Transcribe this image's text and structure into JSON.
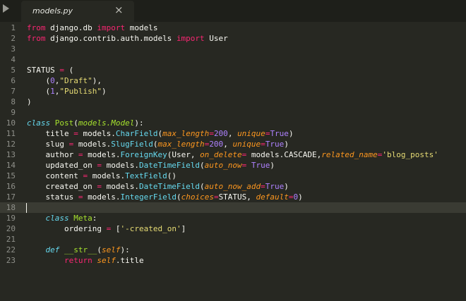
{
  "tab": {
    "title": "models.py",
    "close_glyph": "×"
  },
  "colors": {
    "background": "#272822",
    "tabbar": "#1e1f1a",
    "current_line": "#3a3b33",
    "gutter_text": "#8f908a",
    "keyword": "#f92672",
    "string": "#e6db74",
    "number": "#ae81ff",
    "function": "#66d9ef",
    "class_name": "#a6e22e",
    "argument": "#fd971f"
  },
  "icons": {
    "sidebar_toggle": "triangle-right-icon",
    "close": "close-icon"
  },
  "editor": {
    "current_line": 18,
    "lines": [
      [
        [
          "kw",
          "from"
        ],
        [
          "plain",
          " django.db "
        ],
        [
          "kw",
          "import"
        ],
        [
          "plain",
          " models"
        ]
      ],
      [
        [
          "kw",
          "from"
        ],
        [
          "plain",
          " django.contrib.auth.models "
        ],
        [
          "kw",
          "import"
        ],
        [
          "plain",
          " User"
        ]
      ],
      [],
      [],
      [
        [
          "plain",
          "STATUS "
        ],
        [
          "op",
          "="
        ],
        [
          "plain",
          " ("
        ]
      ],
      [
        [
          "plain",
          "    ("
        ],
        [
          "num",
          "0"
        ],
        [
          "plain",
          ","
        ],
        [
          "str",
          "\"Draft\""
        ],
        [
          "plain",
          "),"
        ]
      ],
      [
        [
          "plain",
          "    ("
        ],
        [
          "num",
          "1"
        ],
        [
          "plain",
          ","
        ],
        [
          "str",
          "\"Publish\""
        ],
        [
          "plain",
          ")"
        ]
      ],
      [
        [
          "plain",
          ")"
        ]
      ],
      [],
      [
        [
          "def",
          "class"
        ],
        [
          "plain",
          " "
        ],
        [
          "cls",
          "Post"
        ],
        [
          "plain",
          "("
        ],
        [
          "base",
          "models.Model"
        ],
        [
          "plain",
          "):"
        ]
      ],
      [
        [
          "plain",
          "    title "
        ],
        [
          "op",
          "="
        ],
        [
          "plain",
          " models."
        ],
        [
          "fn",
          "CharField"
        ],
        [
          "plain",
          "("
        ],
        [
          "arg",
          "max_length"
        ],
        [
          "op",
          "="
        ],
        [
          "num",
          "200"
        ],
        [
          "plain",
          ", "
        ],
        [
          "arg",
          "unique"
        ],
        [
          "op",
          "="
        ],
        [
          "num",
          "True"
        ],
        [
          "plain",
          ")"
        ]
      ],
      [
        [
          "plain",
          "    slug "
        ],
        [
          "op",
          "="
        ],
        [
          "plain",
          " models."
        ],
        [
          "fn",
          "SlugField"
        ],
        [
          "plain",
          "("
        ],
        [
          "arg",
          "max_length"
        ],
        [
          "op",
          "="
        ],
        [
          "num",
          "200"
        ],
        [
          "plain",
          ", "
        ],
        [
          "arg",
          "unique"
        ],
        [
          "op",
          "="
        ],
        [
          "num",
          "True"
        ],
        [
          "plain",
          ")"
        ]
      ],
      [
        [
          "plain",
          "    author "
        ],
        [
          "op",
          "="
        ],
        [
          "plain",
          " models."
        ],
        [
          "fn",
          "ForeignKey"
        ],
        [
          "plain",
          "(User, "
        ],
        [
          "arg",
          "on_delete"
        ],
        [
          "op",
          "="
        ],
        [
          "plain",
          " models.CASCADE,"
        ],
        [
          "arg",
          "related_name"
        ],
        [
          "op",
          "="
        ],
        [
          "str",
          "'blog_posts'"
        ]
      ],
      [
        [
          "plain",
          "    updated_on "
        ],
        [
          "op",
          "="
        ],
        [
          "plain",
          " models."
        ],
        [
          "fn",
          "DateTimeField"
        ],
        [
          "plain",
          "("
        ],
        [
          "arg",
          "auto_now"
        ],
        [
          "op",
          "="
        ],
        [
          "plain",
          " "
        ],
        [
          "num",
          "True"
        ],
        [
          "plain",
          ")"
        ]
      ],
      [
        [
          "plain",
          "    content "
        ],
        [
          "op",
          "="
        ],
        [
          "plain",
          " models."
        ],
        [
          "fn",
          "TextField"
        ],
        [
          "plain",
          "()"
        ]
      ],
      [
        [
          "plain",
          "    created_on "
        ],
        [
          "op",
          "="
        ],
        [
          "plain",
          " models."
        ],
        [
          "fn",
          "DateTimeField"
        ],
        [
          "plain",
          "("
        ],
        [
          "arg",
          "auto_now_add"
        ],
        [
          "op",
          "="
        ],
        [
          "num",
          "True"
        ],
        [
          "plain",
          ")"
        ]
      ],
      [
        [
          "plain",
          "    status "
        ],
        [
          "op",
          "="
        ],
        [
          "plain",
          " models."
        ],
        [
          "fn",
          "IntegerField"
        ],
        [
          "plain",
          "("
        ],
        [
          "arg",
          "choices"
        ],
        [
          "op",
          "="
        ],
        [
          "plain",
          "STATUS, "
        ],
        [
          "arg",
          "default"
        ],
        [
          "op",
          "="
        ],
        [
          "num",
          "0"
        ],
        [
          "plain",
          ")"
        ]
      ],
      [],
      [
        [
          "def",
          "    class"
        ],
        [
          "plain",
          " "
        ],
        [
          "cls",
          "Meta"
        ],
        [
          "plain",
          ":"
        ]
      ],
      [
        [
          "plain",
          "        ordering "
        ],
        [
          "op",
          "="
        ],
        [
          "plain",
          " ["
        ],
        [
          "str",
          "'-created_on'"
        ],
        [
          "plain",
          "]"
        ]
      ],
      [],
      [
        [
          "def",
          "    def"
        ],
        [
          "plain",
          " "
        ],
        [
          "cls",
          "__str__"
        ],
        [
          "plain",
          "("
        ],
        [
          "self",
          "self"
        ],
        [
          "plain",
          "):"
        ]
      ],
      [
        [
          "kw",
          "        return"
        ],
        [
          "plain",
          " "
        ],
        [
          "self",
          "self"
        ],
        [
          "plain",
          ".title"
        ]
      ]
    ]
  }
}
